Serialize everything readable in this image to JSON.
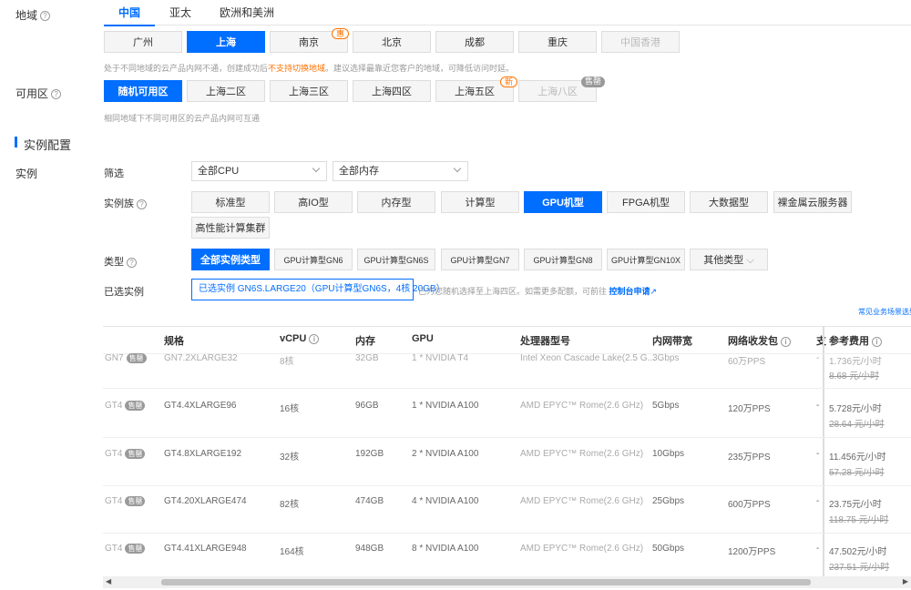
{
  "region": {
    "label": "地域",
    "tabs": [
      "中国",
      "亚太",
      "欧洲和美洲"
    ],
    "cities": [
      "广州",
      "上海",
      "南京",
      "北京",
      "成都",
      "重庆",
      "中国香港"
    ],
    "nanjing_badge": "惠",
    "note_before": "处于不同地域的云产品内网不通，创建成功后",
    "note_warn": "不支持切换地域",
    "note_after": "。建议选择最靠近您客户的地域，可降低访问时延。"
  },
  "zone": {
    "label": "可用区",
    "options": [
      "随机可用区",
      "上海二区",
      "上海三区",
      "上海四区",
      "上海五区",
      "上海八区"
    ],
    "new_badge": "新",
    "soldout_badge": "售罄",
    "note": "相同地域下不同可用区的云产品内网可互通"
  },
  "section_title": "实例配置",
  "instance": {
    "label": "实例",
    "filter_label": "筛选",
    "cpu_select": "全部CPU",
    "mem_select": "全部内存",
    "family_label": "实例族",
    "families": [
      "标准型",
      "高IO型",
      "内存型",
      "计算型",
      "GPU机型",
      "FPGA机型",
      "大数据型",
      "裸金属云服务器",
      "高性能计算集群"
    ],
    "type_label": "类型",
    "types": [
      "全部实例类型",
      "GPU计算型GN6",
      "GPU计算型GN6S",
      "GPU计算型GN7",
      "GPU计算型GN8",
      "GPU计算型GN10X",
      "其他类型"
    ],
    "selected_label": "已选实例",
    "selected_value": "已选实例 GN6S.LARGE20（GPU计算型GN6S，4核 20GB）",
    "selected_note": "已为您随机选择至上海四区。如需更多配额，可前往",
    "selected_link": "控制台申请",
    "faq_link": "常见业务场景选型"
  },
  "table": {
    "headers": [
      "规格",
      "vCPU",
      "内存",
      "GPU",
      "处理器型号",
      "内网带宽",
      "网络收发包",
      "支",
      "参考费用"
    ],
    "rows": [
      {
        "prefix": "GN7",
        "badge": "售罄",
        "spec": "GN7.2XLARGE32",
        "vcpu": "8核",
        "mem": "32GB",
        "gpu": "1 * NVIDIA T4",
        "cpu": "Intel Xeon Cascade Lake(2.5 G...",
        "bw": "3Gbps",
        "pps": "60万PPS",
        "dash": "-",
        "price": "1.736元/小时",
        "orig": "8.68 元/小时"
      },
      {
        "prefix": "GT4",
        "badge": "售罄",
        "spec": "GT4.4XLARGE96",
        "vcpu": "16核",
        "mem": "96GB",
        "gpu": "1 * NVIDIA A100",
        "cpu": "AMD EPYC™ Rome(2.6 GHz)",
        "bw": "5Gbps",
        "pps": "120万PPS",
        "dash": "-",
        "price": "5.728元/小时",
        "orig": "28.64 元/小时"
      },
      {
        "prefix": "GT4",
        "badge": "售罄",
        "spec": "GT4.8XLARGE192",
        "vcpu": "32核",
        "mem": "192GB",
        "gpu": "2 * NVIDIA A100",
        "cpu": "AMD EPYC™ Rome(2.6 GHz)",
        "bw": "10Gbps",
        "pps": "235万PPS",
        "dash": "-",
        "price": "11.456元/小时",
        "orig": "57.28 元/小时"
      },
      {
        "prefix": "GT4",
        "badge": "售罄",
        "spec": "GT4.20XLARGE474",
        "vcpu": "82核",
        "mem": "474GB",
        "gpu": "4 * NVIDIA A100",
        "cpu": "AMD EPYC™ Rome(2.6 GHz)",
        "bw": "25Gbps",
        "pps": "600万PPS",
        "dash": "-",
        "price": "23.75元/小时",
        "orig": "118.75 元/小时"
      },
      {
        "prefix": "GT4",
        "badge": "售罄",
        "spec": "GT4.41XLARGE948",
        "vcpu": "164核",
        "mem": "948GB",
        "gpu": "8 * NVIDIA A100",
        "cpu": "AMD EPYC™ Rome(2.6 GHz)",
        "bw": "50Gbps",
        "pps": "1200万PPS",
        "dash": "-",
        "price": "47.502元/小时",
        "orig": "237.51 元/小时"
      }
    ]
  },
  "colors": {
    "accent": "#006eff",
    "warn": "#ff7200"
  }
}
